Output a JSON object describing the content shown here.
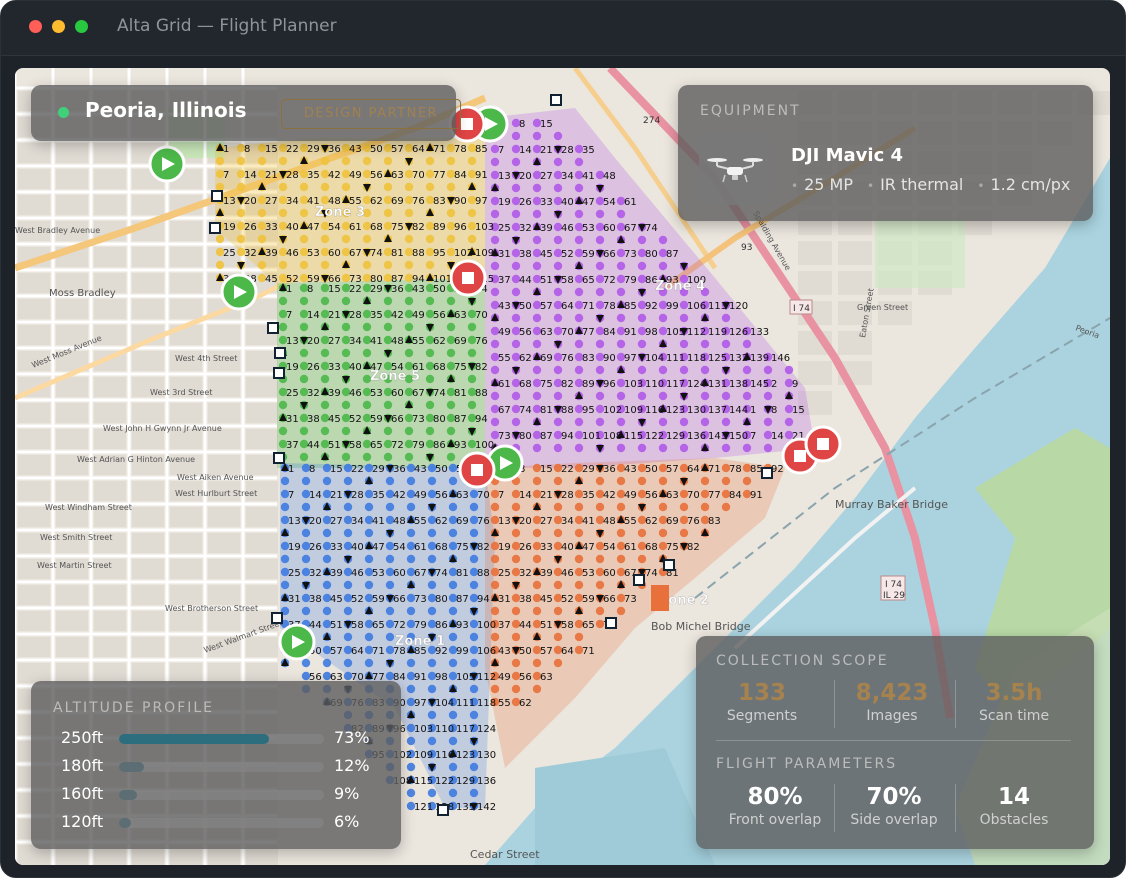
{
  "window": {
    "title": "Alta Grid — Flight Planner"
  },
  "location": {
    "city": "Peoria, Illinois",
    "badge": "DESIGN PARTNER"
  },
  "equipment": {
    "section_label": "EQUIPMENT",
    "name": "DJI Mavic 4",
    "icon": "drone-icon",
    "specs": [
      "25 MP",
      "IR thermal",
      "1.2 cm/px"
    ]
  },
  "altitude_profile": {
    "section_label": "ALTITUDE PROFILE",
    "rows": [
      {
        "altitude": "250ft",
        "percent_label": "73%",
        "fraction": 0.73,
        "color": "#2c6e7d"
      },
      {
        "altitude": "180ft",
        "percent_label": "12%",
        "fraction": 0.12,
        "color": "#5c6e74"
      },
      {
        "altitude": "160ft",
        "percent_label": "9%",
        "fraction": 0.09,
        "color": "#5c6e74"
      },
      {
        "altitude": "120ft",
        "percent_label": "6%",
        "fraction": 0.06,
        "color": "#5c6e74"
      }
    ]
  },
  "collection_scope": {
    "section_label": "COLLECTION SCOPE",
    "stats": [
      {
        "value": "133",
        "label": "Segments"
      },
      {
        "value": "8,423",
        "label": "Images"
      },
      {
        "value": "3.5h",
        "label": "Scan time"
      }
    ],
    "accent_color": "#a6824e"
  },
  "flight_parameters": {
    "section_label": "FLIGHT PARAMETERS",
    "stats": [
      {
        "value": "80%",
        "label": "Front overlap"
      },
      {
        "value": "70%",
        "label": "Side overlap"
      },
      {
        "value": "14",
        "label": "Obstacles"
      }
    ]
  },
  "map": {
    "zones": [
      {
        "label": "Zone 1",
        "color": "#3f7be0"
      },
      {
        "label": "Zone 2",
        "color": "#e8703a"
      },
      {
        "label": "Zone 3",
        "color": "#f0c23c"
      },
      {
        "label": "Zone 4",
        "color": "#b05ae8"
      },
      {
        "label": "Zone 5",
        "color": "#4db84a"
      }
    ],
    "street_labels": [
      "West Bradley Avenue",
      "Moss Bradley",
      "West Moss Avenue",
      "West 4th Street",
      "West 3rd Street",
      "West John H Gwynn Jr Avenue",
      "West Adrian G Hinton Avenue",
      "West Aiken Avenue",
      "West Hurlburt Street",
      "West Windham Street",
      "West Smith Street",
      "West Martin Street",
      "West Brotherson Street",
      "West Walmart Street",
      "Murray Baker Bridge",
      "Bob Michel Bridge",
      "Cedar Street",
      "Spalding Avenue",
      "Eaton Street",
      "Green Street",
      "Peoria"
    ],
    "route_labels": [
      "I 74",
      "IL 29",
      "93",
      "274"
    ]
  }
}
